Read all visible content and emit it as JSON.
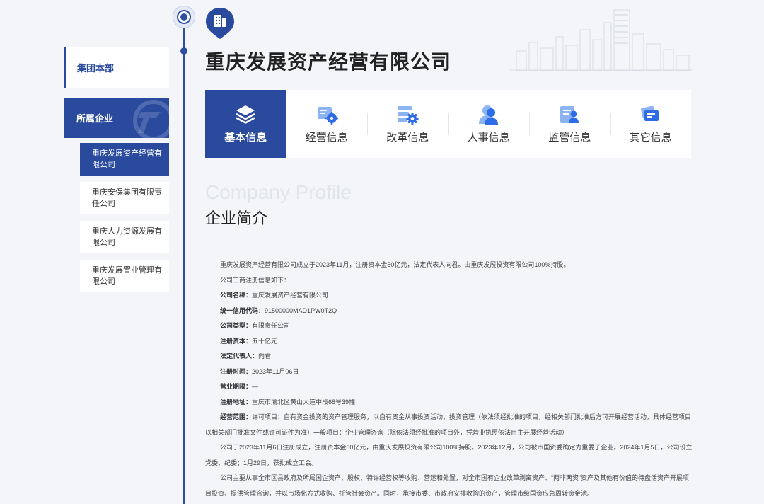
{
  "sidebar": {
    "group_label": "集团本部",
    "subsidiary_label": "所属企业",
    "sub_items": [
      {
        "label": "重庆发展资产经营有限公司"
      },
      {
        "label": "重庆安保集团有限责任公司"
      },
      {
        "label": "重庆人力资源发展有限公司"
      },
      {
        "label": "重庆发展置业管理有限公司"
      }
    ],
    "active_index": 0
  },
  "company": {
    "title": "重庆发展资产经营有限公司"
  },
  "tabs": [
    {
      "label": "基本信息",
      "icon": "layers-icon"
    },
    {
      "label": "经营信息",
      "icon": "business-gear-icon"
    },
    {
      "label": "改革信息",
      "icon": "reform-gear-icon"
    },
    {
      "label": "人事信息",
      "icon": "personnel-icon"
    },
    {
      "label": "监管信息",
      "icon": "supervision-icon"
    },
    {
      "label": "其它信息",
      "icon": "other-info-icon"
    }
  ],
  "active_tab": 0,
  "section": {
    "title_en": "Company Profile",
    "title_cn": "企业简介"
  },
  "profile": {
    "intro": "重庆发展资产经营有限公司成立于2023年11月，注册资本金50亿元，法定代表人向君。由重庆发展投资有限公司100%持股。",
    "reg_intro": "公司工商注册信息如下：",
    "fields": [
      {
        "label": "公司名称：",
        "value": "重庆发展资产经营有限公司"
      },
      {
        "label": "统一信用代码：",
        "value": "91500000MAD1PW0T2Q"
      },
      {
        "label": "公司类型：",
        "value": "有限责任公司"
      },
      {
        "label": "注册资本：",
        "value": "五十亿元"
      },
      {
        "label": "法定代表人：",
        "value": "向君"
      },
      {
        "label": "注册时间：",
        "value": "2023年11月06日"
      },
      {
        "label": "营业期限：",
        "value": "—"
      },
      {
        "label": "注册地址：",
        "value": "重庆市渝北区黄山大道中段68号39幢"
      }
    ],
    "scope_label": "经营范围：",
    "scope_value": "许可项目：自有资金投资的资产管理服务，以自有资金从事投资活动，投资管理（依法须经批准的项目，经相关部门批准后方可开展经营活动，具体经营项目以相关部门批准文件或许可证件为准）一般项目：企业管理咨询（除依法须经批准的项目外，凭营业执照依法自主开展经营活动）",
    "para2": "公司于2023年11月6日注册成立，注册资本金50亿元，由重庆发展投资有限公司100%持股。2023年12月，公司被市国资委确定为重要子企业。2024年1月5日，公司设立党委、纪委；1月29日，获批成立工会。",
    "para3": "公司主要从事全市区县政府及所属国企资产、股权、特许经营权等收购、营运和处置，对全市国有企业改革剥离资产、“两非两资”资产及其他有价值的待盘活资产开展项目投资、提供管理咨询，并以市场化方式收购、托管社会资产。同时，承接市委、市政府安排收购的资产，管理市级国资应急周转资金池。"
  },
  "colors": {
    "primary": "#2a4a9e",
    "background": "#f3f5f9",
    "icon_blue": "#2e6be6"
  }
}
